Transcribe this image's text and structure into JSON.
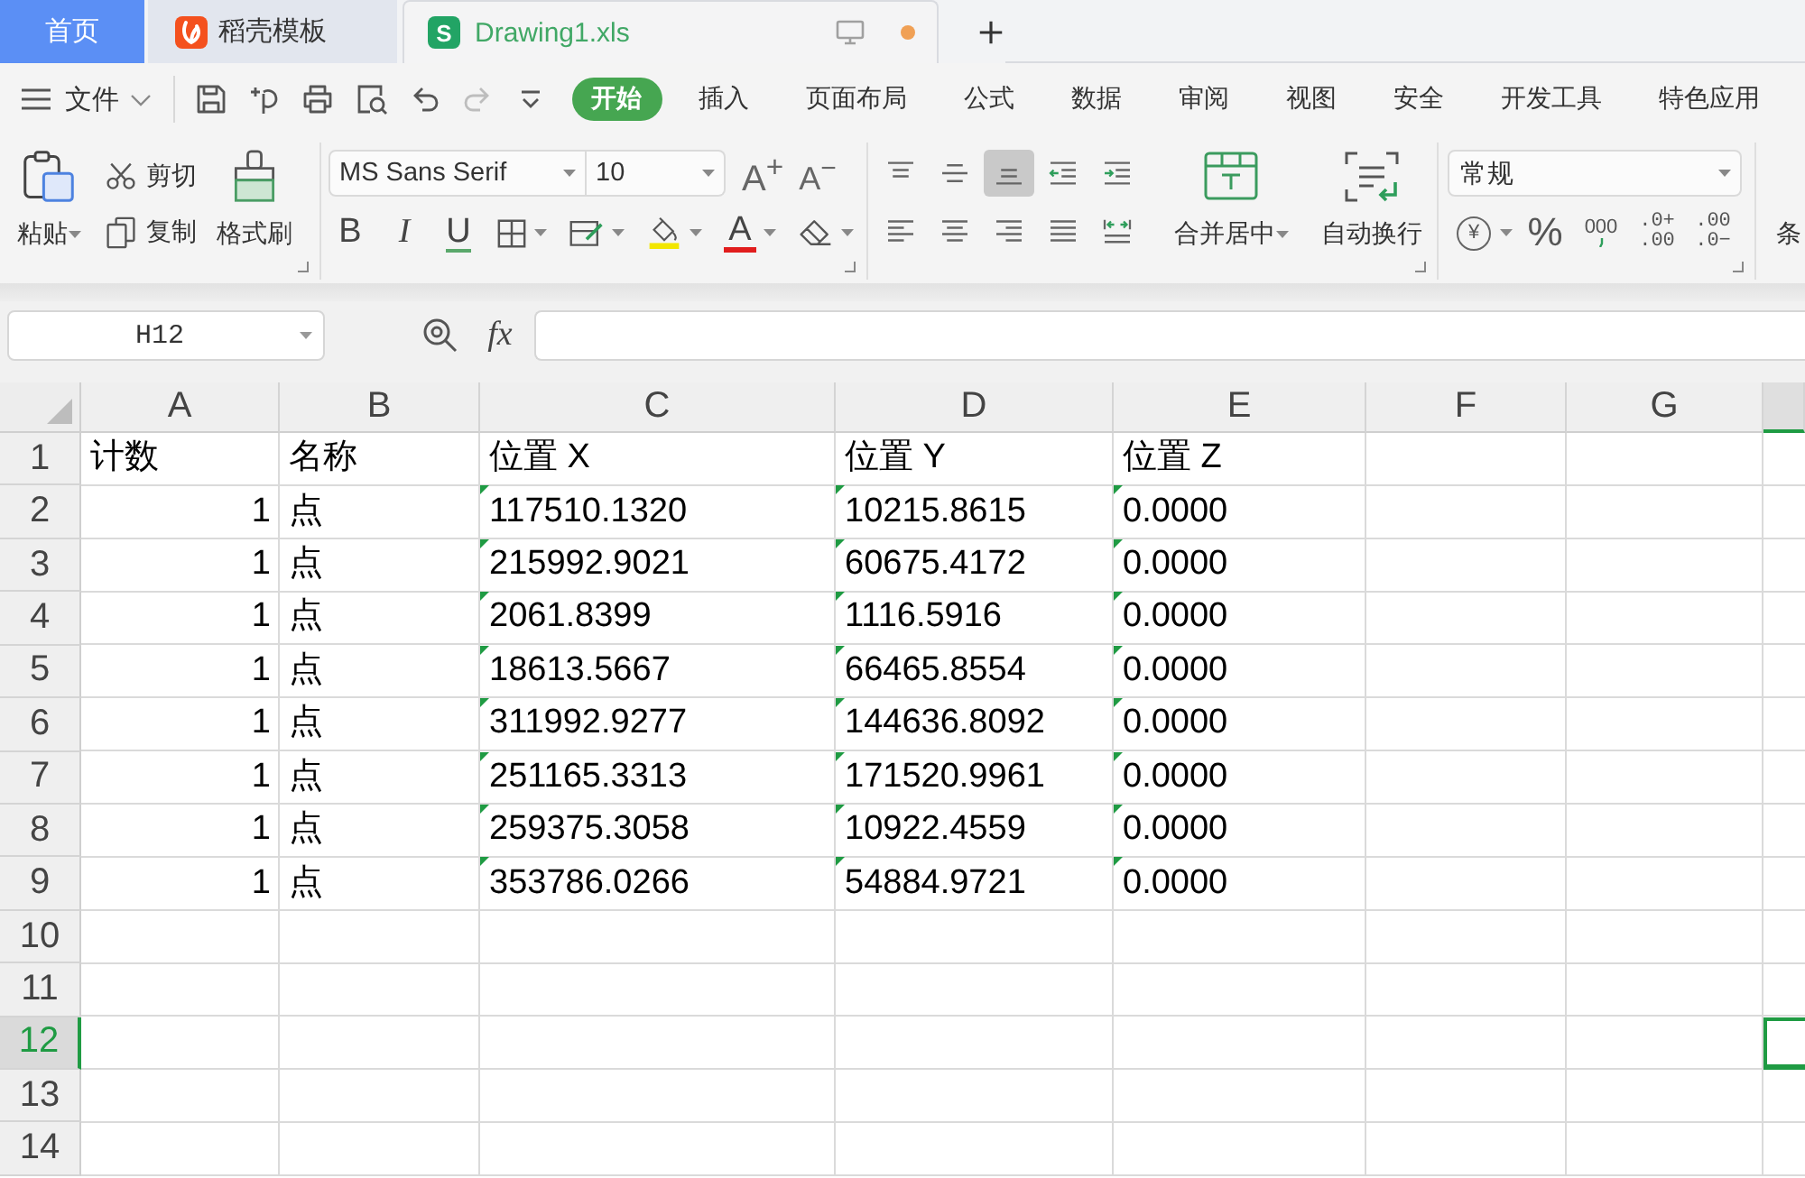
{
  "tabs": [
    {
      "label": "首页",
      "kind": "home",
      "selected": false,
      "unsaved": false
    },
    {
      "label": "稻壳模板",
      "kind": "template",
      "selected": false,
      "unsaved": false
    },
    {
      "label": "Drawing1.xls",
      "kind": "sheet",
      "icon_glyph": "S",
      "selected": true,
      "unsaved": true
    }
  ],
  "menu": {
    "file_label": "文件",
    "quick_access": [
      {
        "kind": "save",
        "disabled": false
      },
      {
        "kind": "export",
        "disabled": false
      },
      {
        "kind": "print",
        "disabled": false
      },
      {
        "kind": "preview",
        "disabled": false
      },
      {
        "kind": "undo",
        "disabled": false
      },
      {
        "kind": "redo",
        "disabled": true
      },
      {
        "kind": "customize",
        "disabled": false
      }
    ],
    "tabs": [
      {
        "label": "开始",
        "selected": true
      },
      {
        "label": "插入",
        "selected": false
      },
      {
        "label": "页面布局",
        "selected": false
      },
      {
        "label": "公式",
        "selected": false
      },
      {
        "label": "数据",
        "selected": false
      },
      {
        "label": "审阅",
        "selected": false
      },
      {
        "label": "视图",
        "selected": false
      },
      {
        "label": "安全",
        "selected": false
      },
      {
        "label": "开发工具",
        "selected": false
      },
      {
        "label": "特色应用",
        "selected": false
      }
    ]
  },
  "ribbon": {
    "clipboard": {
      "paste": "粘贴",
      "cut": "剪切",
      "copy": "复制",
      "format_painter": "格式刷"
    },
    "font": {
      "font_name": "MS Sans Serif",
      "font_size": "10",
      "size_buttons": [
        {
          "kind": "grow",
          "glyph": "A$^{+}$"
        },
        {
          "kind": "shrink",
          "glyph": "A$^{−}$"
        }
      ],
      "format_buttons": [
        {
          "kind": "bold",
          "glyph": "B"
        },
        {
          "kind": "italic",
          "glyph": "I"
        },
        {
          "kind": "underline",
          "glyph": "U"
        },
        {
          "kind": "borders"
        },
        {
          "kind": "cell_style"
        },
        {
          "kind": "fill"
        },
        {
          "kind": "font_color",
          "glyph": "A"
        },
        {
          "kind": "clear"
        }
      ]
    },
    "alignment": {
      "buttons": [
        {
          "kind": "top",
          "selected": false
        },
        {
          "kind": "middle",
          "selected": false
        },
        {
          "kind": "bottom",
          "selected": true
        },
        {
          "kind": "outdent",
          "selected": false
        },
        {
          "kind": "indent",
          "selected": false
        },
        {
          "kind": "left",
          "selected": false
        },
        {
          "kind": "center",
          "selected": false
        },
        {
          "kind": "right",
          "selected": false
        },
        {
          "kind": "justify",
          "selected": false
        },
        {
          "kind": "distributed",
          "selected": false
        }
      ],
      "merge": "合并居中",
      "wrap": "自动换行"
    },
    "number": {
      "format": "常规",
      "buttons": [
        {
          "kind": "currency",
          "glyph": "¥"
        },
        {
          "kind": "percent",
          "glyph": "%"
        },
        {
          "kind": "thousands",
          "glyph": "000"
        },
        {
          "kind": "add_decimal",
          "lines": [
            ".0+",
            ".00"
          ]
        },
        {
          "kind": "remove_decimal",
          "lines": [
            ".00",
            ".0−"
          ]
        }
      ]
    },
    "next_group_label": "条"
  },
  "formula_bar": {
    "name_box": "H12",
    "fx_label": "fx"
  },
  "sheet": {
    "columns": [
      {
        "label": "A",
        "selected": false
      },
      {
        "label": "B",
        "selected": false
      },
      {
        "label": "C",
        "selected": false
      },
      {
        "label": "D",
        "selected": false
      },
      {
        "label": "E",
        "selected": false
      },
      {
        "label": "F",
        "selected": false
      },
      {
        "label": "G",
        "selected": false
      },
      {
        "selected": true
      }
    ],
    "rows": [
      {
        "label": "1",
        "selected": false,
        "cells": [
          {
            "text": "计数",
            "kind": "text"
          },
          {
            "text": "名称",
            "kind": "text"
          },
          {
            "text": "位置 X",
            "kind": "text"
          },
          {
            "text": "位置 Y",
            "kind": "text"
          },
          {
            "text": "位置 Z",
            "kind": "text"
          }
        ]
      },
      {
        "label": "2",
        "selected": false,
        "cells": [
          {
            "text": "1",
            "kind": "number"
          },
          {
            "text": "点",
            "kind": "text"
          },
          {
            "text": "117510.1320",
            "kind": "number_text"
          },
          {
            "text": "10215.8615",
            "kind": "number_text"
          },
          {
            "text": "0.0000",
            "kind": "number_text"
          }
        ]
      },
      {
        "label": "3",
        "selected": false,
        "cells": [
          {
            "text": "1",
            "kind": "number"
          },
          {
            "text": "点",
            "kind": "text"
          },
          {
            "text": "215992.9021",
            "kind": "number_text"
          },
          {
            "text": "60675.4172",
            "kind": "number_text"
          },
          {
            "text": "0.0000",
            "kind": "number_text"
          }
        ]
      },
      {
        "label": "4",
        "selected": false,
        "cells": [
          {
            "text": "1",
            "kind": "number"
          },
          {
            "text": "点",
            "kind": "text"
          },
          {
            "text": "2061.8399",
            "kind": "number_text"
          },
          {
            "text": "1116.5916",
            "kind": "number_text"
          },
          {
            "text": "0.0000",
            "kind": "number_text"
          }
        ]
      },
      {
        "label": "5",
        "selected": false,
        "cells": [
          {
            "text": "1",
            "kind": "number"
          },
          {
            "text": "点",
            "kind": "text"
          },
          {
            "text": "18613.5667",
            "kind": "number_text"
          },
          {
            "text": "66465.8554",
            "kind": "number_text"
          },
          {
            "text": "0.0000",
            "kind": "number_text"
          }
        ]
      },
      {
        "label": "6",
        "selected": false,
        "cells": [
          {
            "text": "1",
            "kind": "number"
          },
          {
            "text": "点",
            "kind": "text"
          },
          {
            "text": "311992.9277",
            "kind": "number_text"
          },
          {
            "text": "144636.8092",
            "kind": "number_text"
          },
          {
            "text": "0.0000",
            "kind": "number_text"
          }
        ]
      },
      {
        "label": "7",
        "selected": false,
        "cells": [
          {
            "text": "1",
            "kind": "number"
          },
          {
            "text": "点",
            "kind": "text"
          },
          {
            "text": "251165.3313",
            "kind": "number_text"
          },
          {
            "text": "171520.9961",
            "kind": "number_text"
          },
          {
            "text": "0.0000",
            "kind": "number_text"
          }
        ]
      },
      {
        "label": "8",
        "selected": false,
        "cells": [
          {
            "text": "1",
            "kind": "number"
          },
          {
            "text": "点",
            "kind": "text"
          },
          {
            "text": "259375.3058",
            "kind": "number_text"
          },
          {
            "text": "10922.4559",
            "kind": "number_text"
          },
          {
            "text": "0.0000",
            "kind": "number_text"
          }
        ]
      },
      {
        "label": "9",
        "selected": false,
        "cells": [
          {
            "text": "1",
            "kind": "number"
          },
          {
            "text": "点",
            "kind": "text"
          },
          {
            "text": "353786.0266",
            "kind": "number_text"
          },
          {
            "text": "54884.9721",
            "kind": "number_text"
          },
          {
            "text": "0.0000",
            "kind": "number_text"
          }
        ]
      },
      {
        "label": "10",
        "selected": false
      },
      {
        "label": "11",
        "selected": false
      },
      {
        "label": "12",
        "selected": true
      },
      {
        "label": "13",
        "selected": false
      },
      {
        "label": "14",
        "selected": false
      }
    ]
  }
}
